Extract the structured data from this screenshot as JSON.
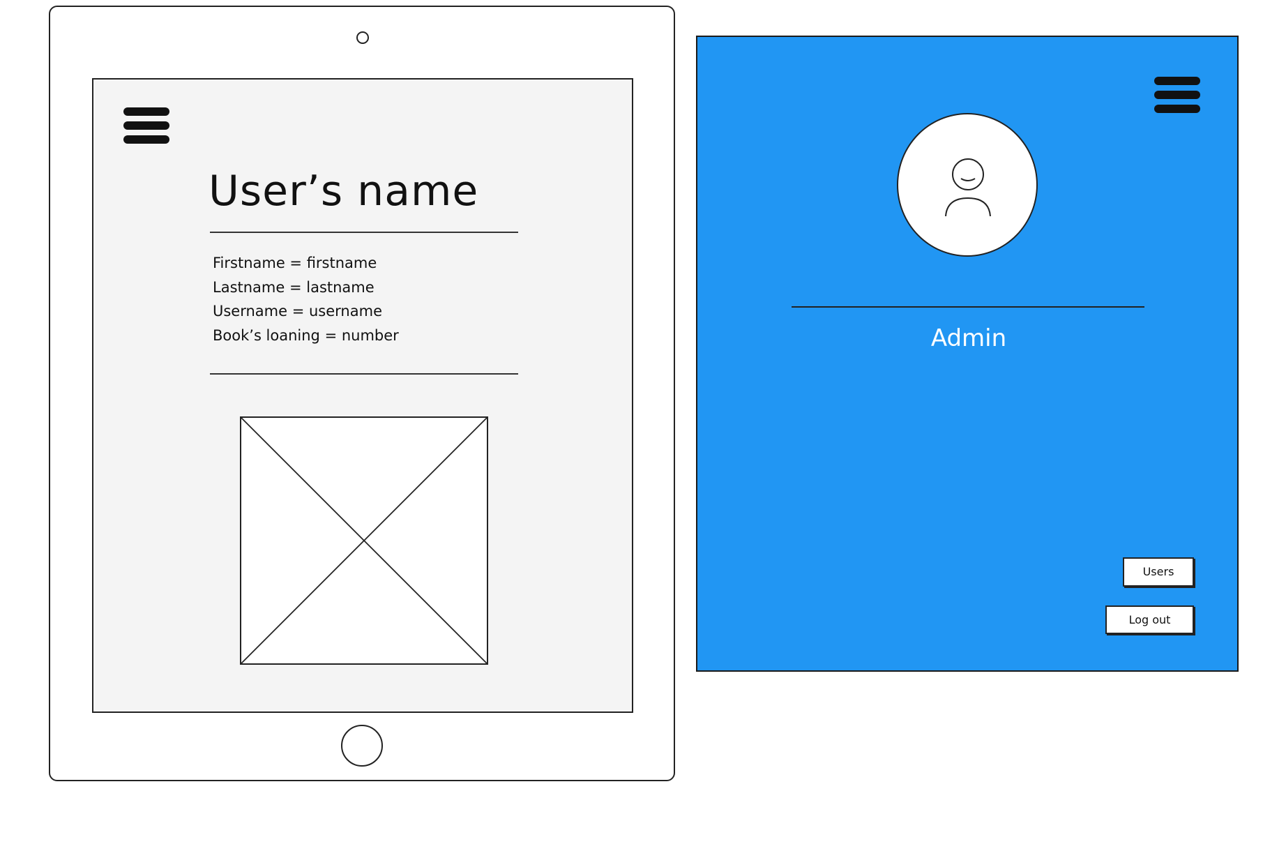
{
  "profile_screen": {
    "title": "User’s name",
    "fields": [
      "Firstname = firstname",
      "Lastname = lastname",
      "Username = username",
      "Book’s loaning = number"
    ],
    "menu_icon": "hamburger-menu-icon",
    "image_icon": "image-placeholder-icon"
  },
  "side_panel": {
    "background_color": "#2196f3",
    "menu_icon": "hamburger-menu-icon",
    "avatar_icon": "user-avatar-icon",
    "role_label": "Admin",
    "buttons": {
      "users": "Users",
      "logout": "Log out"
    }
  }
}
